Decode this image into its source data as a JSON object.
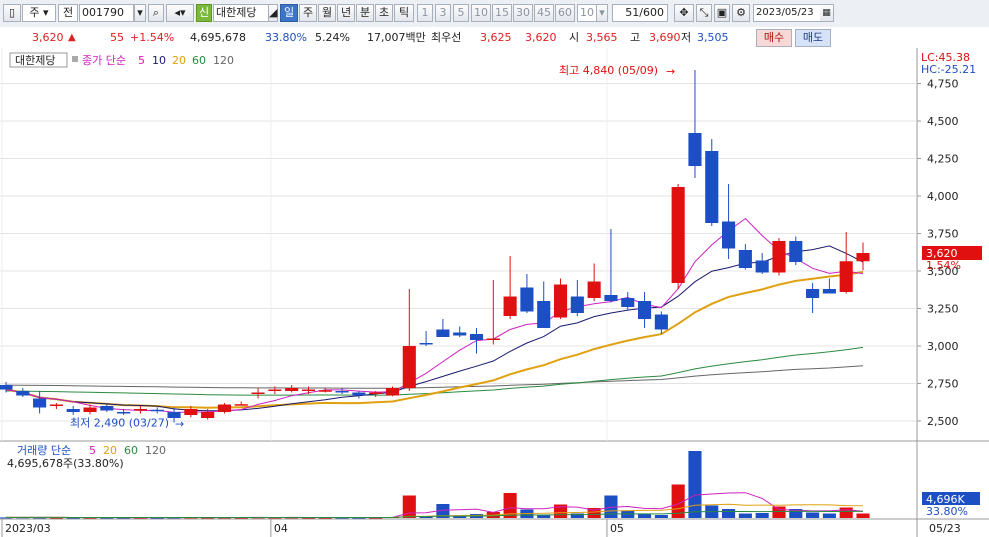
{
  "toolbar": {
    "market": "주",
    "mode": "전",
    "code": "001790",
    "name": "대한제당",
    "credit": "신",
    "periods": [
      "일",
      "주",
      "월",
      "년",
      "분",
      "초",
      "틱"
    ],
    "minutes": [
      "1",
      "3",
      "5",
      "10",
      "15",
      "30",
      "45",
      "60"
    ],
    "interval": "10",
    "count": "51/600",
    "date": "2023/05/23"
  },
  "info": {
    "price": "3,620",
    "arrow": "▲",
    "change": "55",
    "change_pct": "+1.54%",
    "volume": "4,695,678",
    "vol_ratio": "33.80%",
    "turnover": "5.24%",
    "amount": "17,007백만",
    "best_label": "최우선",
    "best_ask": "3,625",
    "best_bid": "3,620",
    "open_label": "시",
    "open": "3,565",
    "high_label": "고",
    "high": "3,690",
    "low_label": "저",
    "low": "3,505",
    "buy_label": "매수",
    "sell_label": "매도"
  },
  "chart_data": {
    "type": "candlestick",
    "stock_label": "대한제당",
    "legend": {
      "price": "종가 단순",
      "ma": [
        "5",
        "10",
        "20",
        "60",
        "120"
      ],
      "volume": "거래량 단순",
      "vol_ma": [
        "5",
        "20",
        "60",
        "120"
      ]
    },
    "colors": {
      "up": "#e01010",
      "down": "#1c4fc4",
      "ma5": "#d020c0",
      "ma10": "#1a1a6e",
      "ma20": "#e0a010",
      "ma60": "#2a8a40",
      "ma120": "#666666"
    },
    "ylim": [
      2400,
      4900
    ],
    "yticks": [
      "2,500",
      "2,750",
      "3,000",
      "3,250",
      "3,500",
      "3,750",
      "4,000",
      "4,250",
      "4,500",
      "4,750"
    ],
    "ytick_values": [
      2500,
      2750,
      3000,
      3250,
      3500,
      3750,
      4000,
      4250,
      4500,
      4750
    ],
    "xticks": [
      {
        "label": "2023/03",
        "i": 0
      },
      {
        "label": "04",
        "i": 16
      },
      {
        "label": "05",
        "i": 36
      }
    ],
    "last_date_label": "05/23",
    "lc": "LC:45.38",
    "hc": "HC:-25.21",
    "current_price_label": "3,620",
    "current_pct_label": "1.54%",
    "max_label": "최고 4,840 (05/09)",
    "min_label": "최저 2,490 (03/27)",
    "max_i": 40,
    "min_i": 10,
    "max_val": 4840,
    "min_val": 2490,
    "vol_info": "4,695,678주(33.80%)",
    "vol_box_label": "4,696K",
    "vol_box_pct": "33.80%",
    "vol_max": 14000000,
    "candles": [
      {
        "o": 2740,
        "h": 2760,
        "l": 2690,
        "c": 2710
      },
      {
        "o": 2700,
        "h": 2720,
        "l": 2660,
        "c": 2670
      },
      {
        "o": 2650,
        "h": 2700,
        "l": 2550,
        "c": 2590
      },
      {
        "o": 2600,
        "h": 2620,
        "l": 2580,
        "c": 2610
      },
      {
        "o": 2580,
        "h": 2600,
        "l": 2540,
        "c": 2560
      },
      {
        "o": 2560,
        "h": 2610,
        "l": 2545,
        "c": 2590
      },
      {
        "o": 2600,
        "h": 2610,
        "l": 2560,
        "c": 2570
      },
      {
        "o": 2560,
        "h": 2580,
        "l": 2540,
        "c": 2550
      },
      {
        "o": 2570,
        "h": 2600,
        "l": 2550,
        "c": 2580
      },
      {
        "o": 2575,
        "h": 2590,
        "l": 2550,
        "c": 2565
      },
      {
        "o": 2560,
        "h": 2590,
        "l": 2490,
        "c": 2520
      },
      {
        "o": 2540,
        "h": 2600,
        "l": 2525,
        "c": 2580
      },
      {
        "o": 2520,
        "h": 2580,
        "l": 2510,
        "c": 2560
      },
      {
        "o": 2560,
        "h": 2620,
        "l": 2550,
        "c": 2610
      },
      {
        "o": 2610,
        "h": 2630,
        "l": 2605,
        "c": 2612
      },
      {
        "o": 2680,
        "h": 2720,
        "l": 2650,
        "c": 2690
      },
      {
        "o": 2700,
        "h": 2730,
        "l": 2680,
        "c": 2710
      },
      {
        "o": 2700,
        "h": 2740,
        "l": 2690,
        "c": 2720
      },
      {
        "o": 2700,
        "h": 2730,
        "l": 2680,
        "c": 2710
      },
      {
        "o": 2700,
        "h": 2720,
        "l": 2690,
        "c": 2705
      },
      {
        "o": 2700,
        "h": 2720,
        "l": 2680,
        "c": 2690
      },
      {
        "o": 2690,
        "h": 2700,
        "l": 2650,
        "c": 2670
      },
      {
        "o": 2680,
        "h": 2700,
        "l": 2660,
        "c": 2690
      },
      {
        "o": 2670,
        "h": 2730,
        "l": 2665,
        "c": 2720
      },
      {
        "o": 2720,
        "h": 3380,
        "l": 2700,
        "c": 3000
      },
      {
        "o": 3020,
        "h": 3100,
        "l": 3000,
        "c": 3010
      },
      {
        "o": 3110,
        "h": 3180,
        "l": 3080,
        "c": 3060
      },
      {
        "o": 3090,
        "h": 3130,
        "l": 3060,
        "c": 3070
      },
      {
        "o": 3080,
        "h": 3120,
        "l": 2950,
        "c": 3040
      },
      {
        "o": 3040,
        "h": 3440,
        "l": 3010,
        "c": 3050
      },
      {
        "o": 3200,
        "h": 3600,
        "l": 3180,
        "c": 3330
      },
      {
        "o": 3390,
        "h": 3480,
        "l": 3220,
        "c": 3230
      },
      {
        "o": 3300,
        "h": 3430,
        "l": 3200,
        "c": 3120
      },
      {
        "o": 3190,
        "h": 3450,
        "l": 3180,
        "c": 3410
      },
      {
        "o": 3330,
        "h": 3440,
        "l": 3200,
        "c": 3220
      },
      {
        "o": 3320,
        "h": 3550,
        "l": 3300,
        "c": 3430
      },
      {
        "o": 3340,
        "h": 3780,
        "l": 3290,
        "c": 3300
      },
      {
        "o": 3320,
        "h": 3360,
        "l": 3240,
        "c": 3260
      },
      {
        "o": 3300,
        "h": 3360,
        "l": 3120,
        "c": 3180
      },
      {
        "o": 3210,
        "h": 3230,
        "l": 3080,
        "c": 3110
      },
      {
        "o": 3420,
        "h": 4080,
        "l": 3380,
        "c": 4060
      },
      {
        "o": 4420,
        "h": 4840,
        "l": 4120,
        "c": 4200
      },
      {
        "o": 4300,
        "h": 4380,
        "l": 3800,
        "c": 3820
      },
      {
        "o": 3830,
        "h": 4080,
        "l": 3580,
        "c": 3650
      },
      {
        "o": 3640,
        "h": 3680,
        "l": 3510,
        "c": 3520
      },
      {
        "o": 3570,
        "h": 3620,
        "l": 3480,
        "c": 3490
      },
      {
        "o": 3490,
        "h": 3720,
        "l": 3470,
        "c": 3700
      },
      {
        "o": 3700,
        "h": 3730,
        "l": 3540,
        "c": 3560
      },
      {
        "o": 3380,
        "h": 3420,
        "l": 3220,
        "c": 3320
      },
      {
        "o": 3380,
        "h": 3450,
        "l": 3360,
        "c": 3350
      },
      {
        "o": 3360,
        "h": 3760,
        "l": 3350,
        "c": 3565
      },
      {
        "o": 3565,
        "h": 3690,
        "l": 3505,
        "c": 3620
      }
    ],
    "volume": [
      120000,
      140000,
      110000,
      90000,
      80000,
      100000,
      90000,
      80000,
      90000,
      70000,
      110000,
      120000,
      100000,
      110000,
      90000,
      130000,
      110000,
      120000,
      90000,
      90000,
      100000,
      90000,
      80000,
      200000,
      4500000,
      300000,
      2800000,
      500000,
      800000,
      1200000,
      5000000,
      1700000,
      600000,
      2700000,
      900000,
      2000000,
      4500000,
      1400000,
      800000,
      600000,
      6700000,
      13400000,
      2500000,
      1800000,
      900000,
      1000000,
      2300000,
      1800000,
      1100000,
      900000,
      2100000,
      900000
    ]
  }
}
